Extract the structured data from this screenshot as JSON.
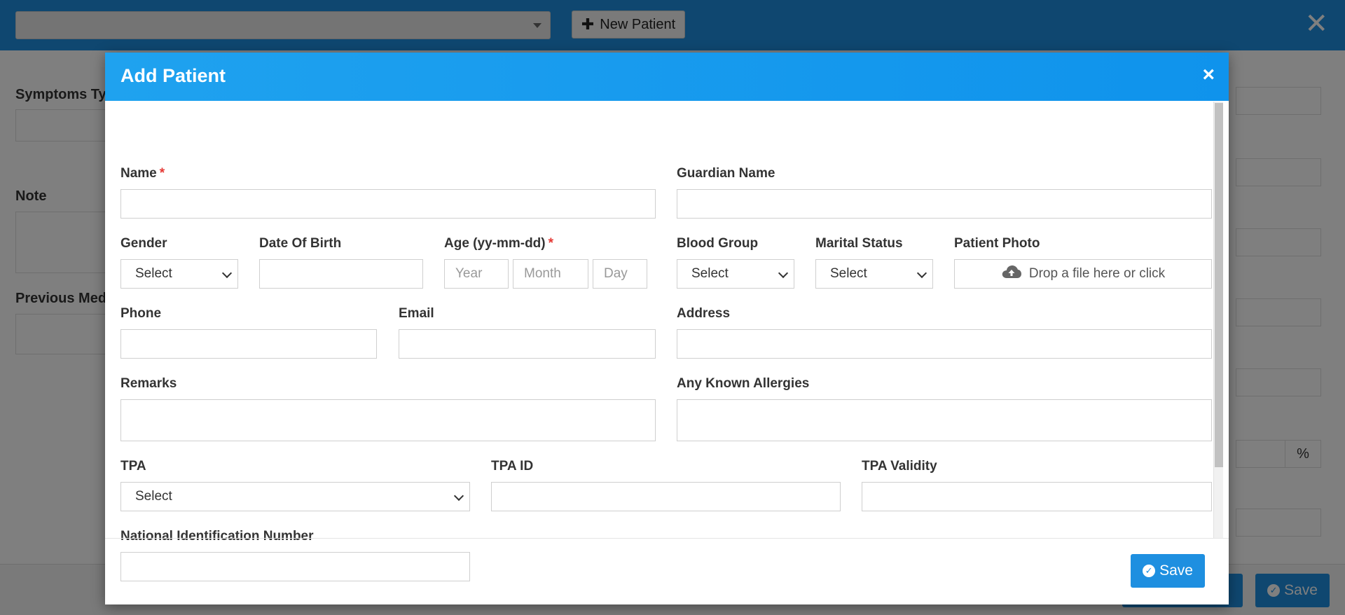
{
  "background": {
    "new_patient_label": "New Patient",
    "labels": {
      "symptoms_type": "Symptoms Typ",
      "note": "Note",
      "previous_medical": "Previous Medi"
    },
    "save_label": "Save",
    "percent": "%"
  },
  "modal": {
    "title": "Add Patient",
    "fields": {
      "name": "Name",
      "guardian_name": "Guardian Name",
      "gender": "Gender",
      "gender_value": "Select",
      "date_of_birth": "Date Of Birth",
      "age": "Age (yy-mm-dd)",
      "age_year_placeholder": "Year",
      "age_month_placeholder": "Month",
      "age_day_placeholder": "Day",
      "blood_group": "Blood Group",
      "blood_group_value": "Select",
      "marital_status": "Marital Status",
      "marital_status_value": "Select",
      "patient_photo": "Patient Photo",
      "patient_photo_drop": "Drop a file here or click",
      "phone": "Phone",
      "email": "Email",
      "address": "Address",
      "remarks": "Remarks",
      "any_known_allergies": "Any Known Allergies",
      "tpa": "TPA",
      "tpa_value": "Select",
      "tpa_id": "TPA ID",
      "tpa_validity": "TPA Validity",
      "national_id": "National Identification Number"
    },
    "save_label": "Save"
  },
  "colors": {
    "header_blue": "#1fa2ef",
    "button_blue": "#1e8fe0",
    "required_red": "#e53935"
  },
  "icons": [
    "plus-icon",
    "close-icon",
    "cloud-upload-icon",
    "check-circle-icon",
    "chevron-down-icon"
  ]
}
